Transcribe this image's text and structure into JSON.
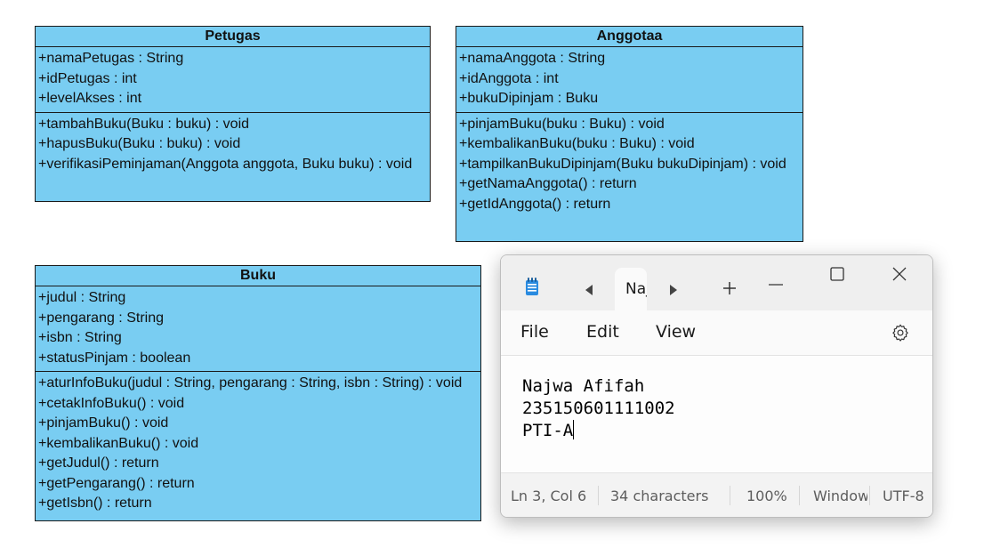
{
  "diagram": {
    "petugas": {
      "title": "Petugas",
      "attributes": [
        "+namaPetugas : String",
        "+idPetugas : int",
        "+levelAkses : int"
      ],
      "methods": [
        "+tambahBuku(Buku : buku) : void",
        "+hapusBuku(Buku : buku) : void",
        "+verifikasiPeminjaman(Anggota anggota, Buku buku) : void"
      ]
    },
    "anggota": {
      "title": "Anggotaa",
      "attributes": [
        "+namaAnggota : String",
        "+idAnggota : int",
        "+bukuDipinjam : Buku"
      ],
      "methods": [
        "+pinjamBuku(buku : Buku) : void",
        "+kembalikanBuku(buku : Buku) : void",
        "+tampilkanBukuDipinjam(Buku bukuDipinjam) : void",
        "+getNamaAnggota() : return",
        "+getIdAnggota() : return"
      ]
    },
    "buku": {
      "title": "Buku",
      "attributes": [
        "+judul : String",
        "+pengarang : String",
        "+isbn : String",
        "+statusPinjam : boolean"
      ],
      "methods": [
        "+aturInfoBuku(judul : String, pengarang : String, isbn : String) : void",
        "+cetakInfoBuku() : void",
        "+pinjamBuku() : void",
        "+kembalikanBuku() : void",
        "+getJudul() : return",
        "+getPengarang() : return",
        "+getIsbn() : return"
      ]
    },
    "box_color": "#79CDF2"
  },
  "notepad": {
    "tab_label": "Naj",
    "menu": {
      "file": "File",
      "edit": "Edit",
      "view": "View"
    },
    "content_lines": [
      "Najwa Afifah",
      "235150601111002",
      "PTI-A"
    ],
    "status": {
      "position": "Ln 3, Col 6",
      "characters": "34 characters",
      "zoom": "100%",
      "line_ending": "Window",
      "encoding": "UTF-8"
    },
    "icons": [
      "notepad-app-icon",
      "tab-scroll-left-icon",
      "tab-scroll-right-icon",
      "new-tab-icon",
      "minimize-icon",
      "maximize-icon",
      "close-icon",
      "settings-gear-icon"
    ]
  }
}
